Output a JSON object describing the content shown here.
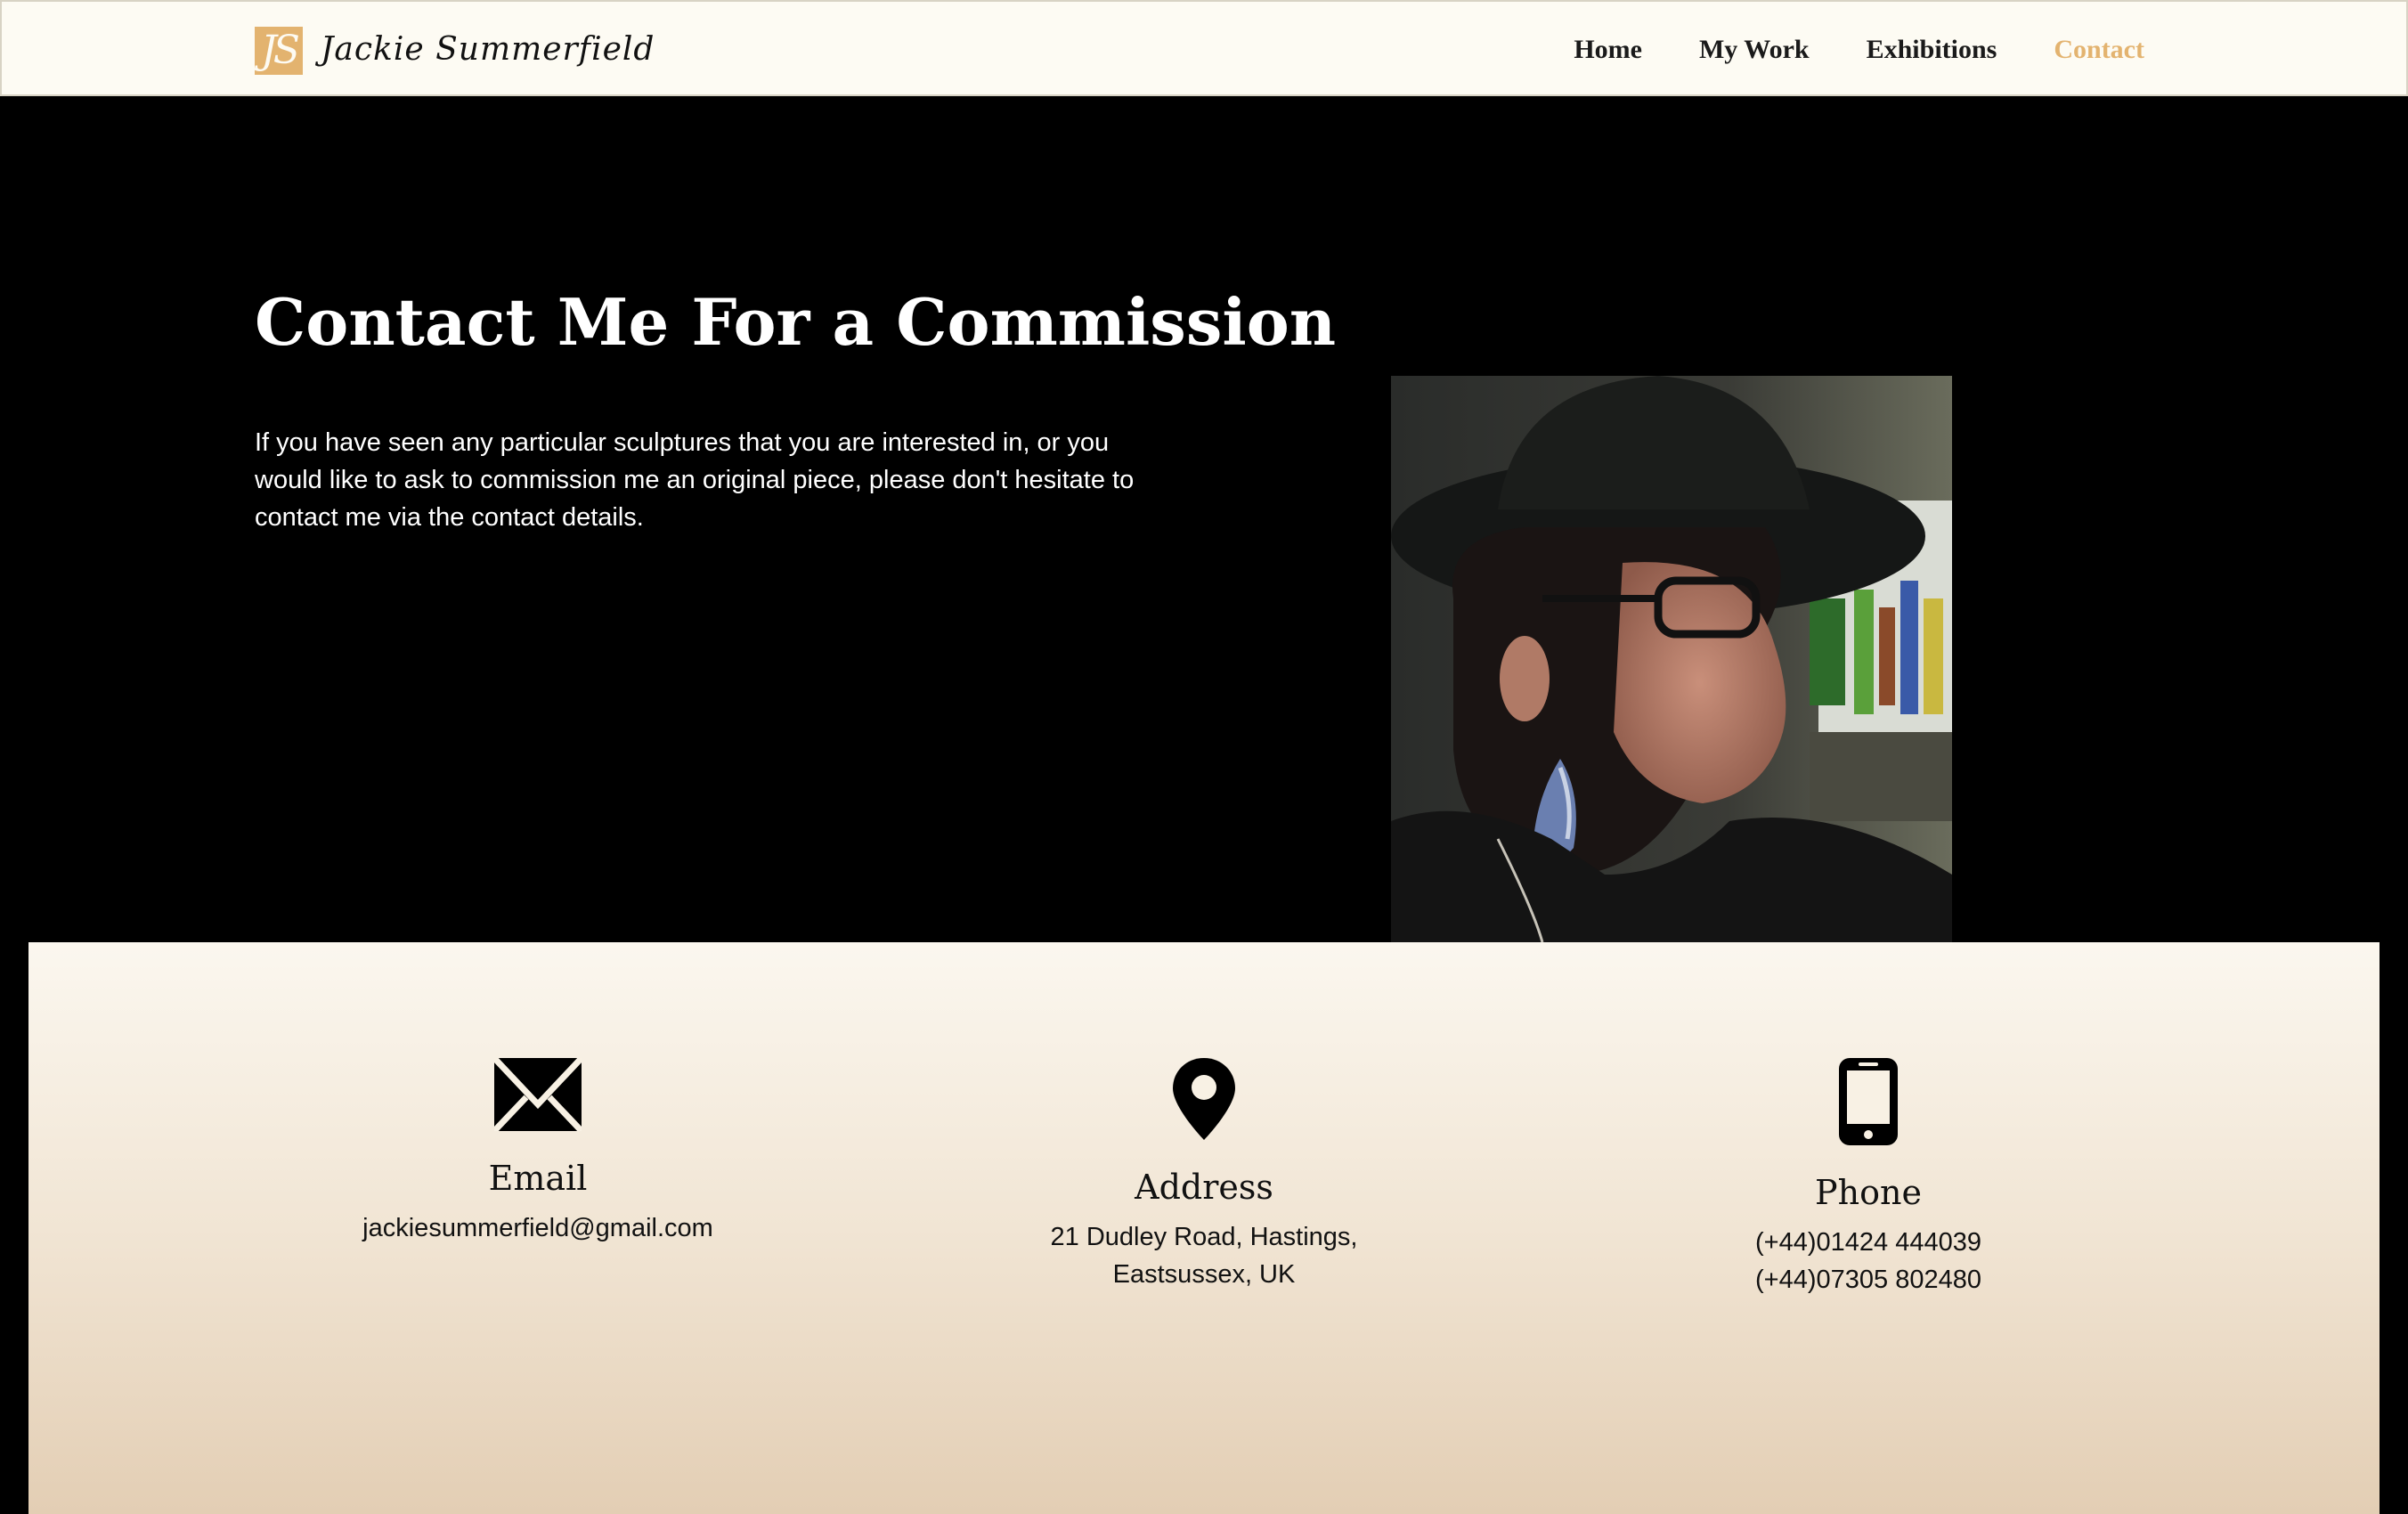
{
  "header": {
    "logo_mark": "JS",
    "logo_text": "Jackie Summerfield",
    "nav": [
      {
        "label": "Home"
      },
      {
        "label": "My Work"
      },
      {
        "label": "Exhibitions"
      },
      {
        "label": "Contact"
      }
    ],
    "active_nav": "Contact",
    "accent_color": "#e3b36f"
  },
  "hero": {
    "title": "Contact Me For a Commission",
    "text": "If you have seen any particular sculptures that you are interested in, or you would like to ask to commission me an original piece, please don't hesitate to contact me via the contact details.",
    "image": "portrait-photo"
  },
  "contact": {
    "email": {
      "icon": "envelope-icon",
      "title": "Email",
      "lines": [
        "jackiesummerfield@gmail.com"
      ]
    },
    "address": {
      "icon": "map-pin-icon",
      "title": "Address",
      "lines": [
        "21 Dudley Road, Hastings,",
        "Eastsussex, UK"
      ]
    },
    "phone": {
      "icon": "mobile-phone-icon",
      "title": "Phone",
      "lines": [
        "(+44)01424 444039",
        "(+44)07305 802480"
      ]
    }
  }
}
